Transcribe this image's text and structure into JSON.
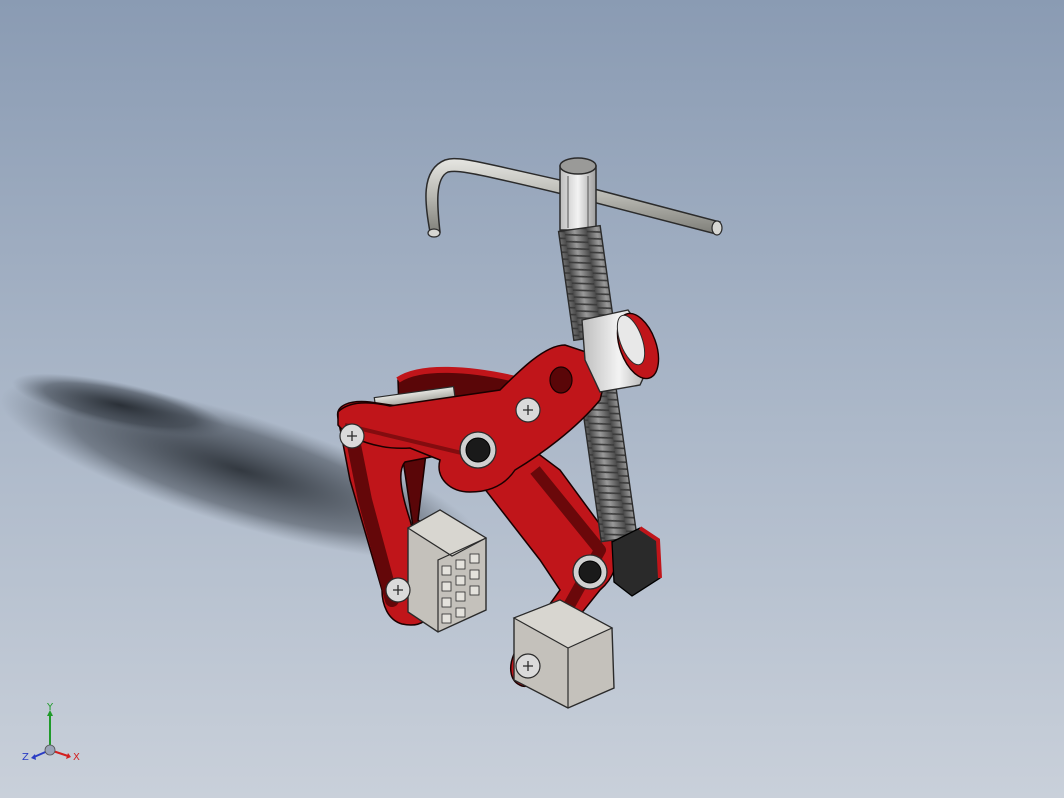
{
  "view": {
    "background_top": "#8a9bb3",
    "background_bottom": "#c9d0da"
  },
  "model": {
    "part_colors": {
      "lever_arms": "#c0151a",
      "lever_shadow": "#5a0608",
      "screw": "#6e6e6e",
      "handle": "#b5b5b0",
      "jaw_blocks": "#c4c1bb",
      "hex_nut": "#2a2a2a"
    }
  },
  "triad": {
    "x_label": "X",
    "y_label": "Y",
    "z_label": "Z",
    "x_color": "#d32020",
    "y_color": "#1f9a2a",
    "z_color": "#2a3cc4"
  }
}
